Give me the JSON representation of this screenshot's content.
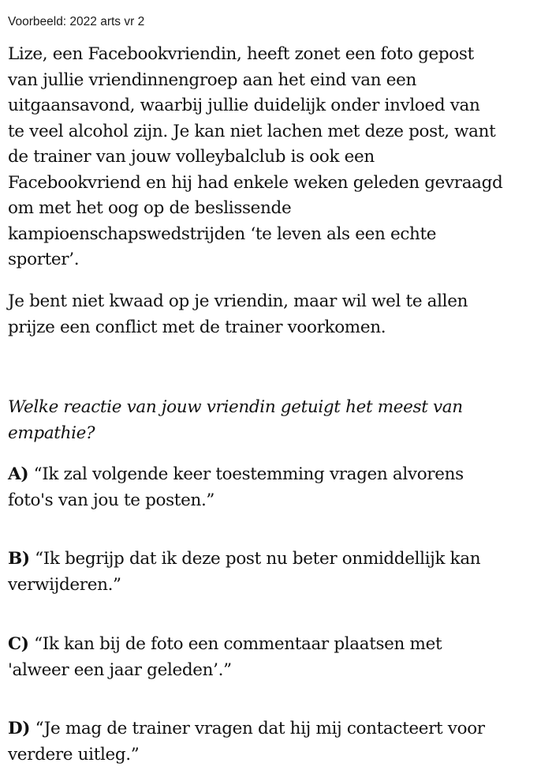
{
  "header": {
    "caption": "Voorbeeld: 2022 arts vr 2"
  },
  "scenario": {
    "paragraph1_lines": [
      "Lize, een Facebookvriendin, heeft zonet een foto gepost",
      "van jullie vriendinnengroep aan het eind van een",
      "uitgaansavond, waarbij jullie duidelijk onder invloed van",
      "te veel alcohol zijn. Je kan niet lachen met deze post, want",
      "de trainer van jouw volleybalclub is ook een",
      "Facebookvriend en hij had enkele weken geleden gevraagd",
      "om met het oog op de beslissende",
      "kampioenschapswedstrijden ‘te leven als een echte",
      "sporter’."
    ],
    "paragraph2_lines": [
      "Je bent niet kwaad op je vriendin, maar wil wel te allen",
      "prijze een conflict met de trainer voorkomen."
    ]
  },
  "question": {
    "lines": [
      "Welke reactie van jouw vriendin getuigt het meest van",
      "empathie?"
    ]
  },
  "options": [
    {
      "letter": "A)",
      "line1": " “Ik zal volgende keer toestemming vragen alvorens",
      "line2": "foto's van jou te posten.”"
    },
    {
      "letter": "B)",
      "line1": " “Ik begrijp dat ik deze post nu beter onmiddellijk kan",
      "line2": "verwijderen.”"
    },
    {
      "letter": "C)",
      "line1": " “Ik kan bij de foto een commentaar plaatsen met",
      "line2": "'alweer een jaar geleden’.”"
    },
    {
      "letter": "D)",
      "line1": " “Je mag de trainer vragen dat hij mij contacteert voor",
      "line2": "verdere uitleg.”"
    }
  ]
}
